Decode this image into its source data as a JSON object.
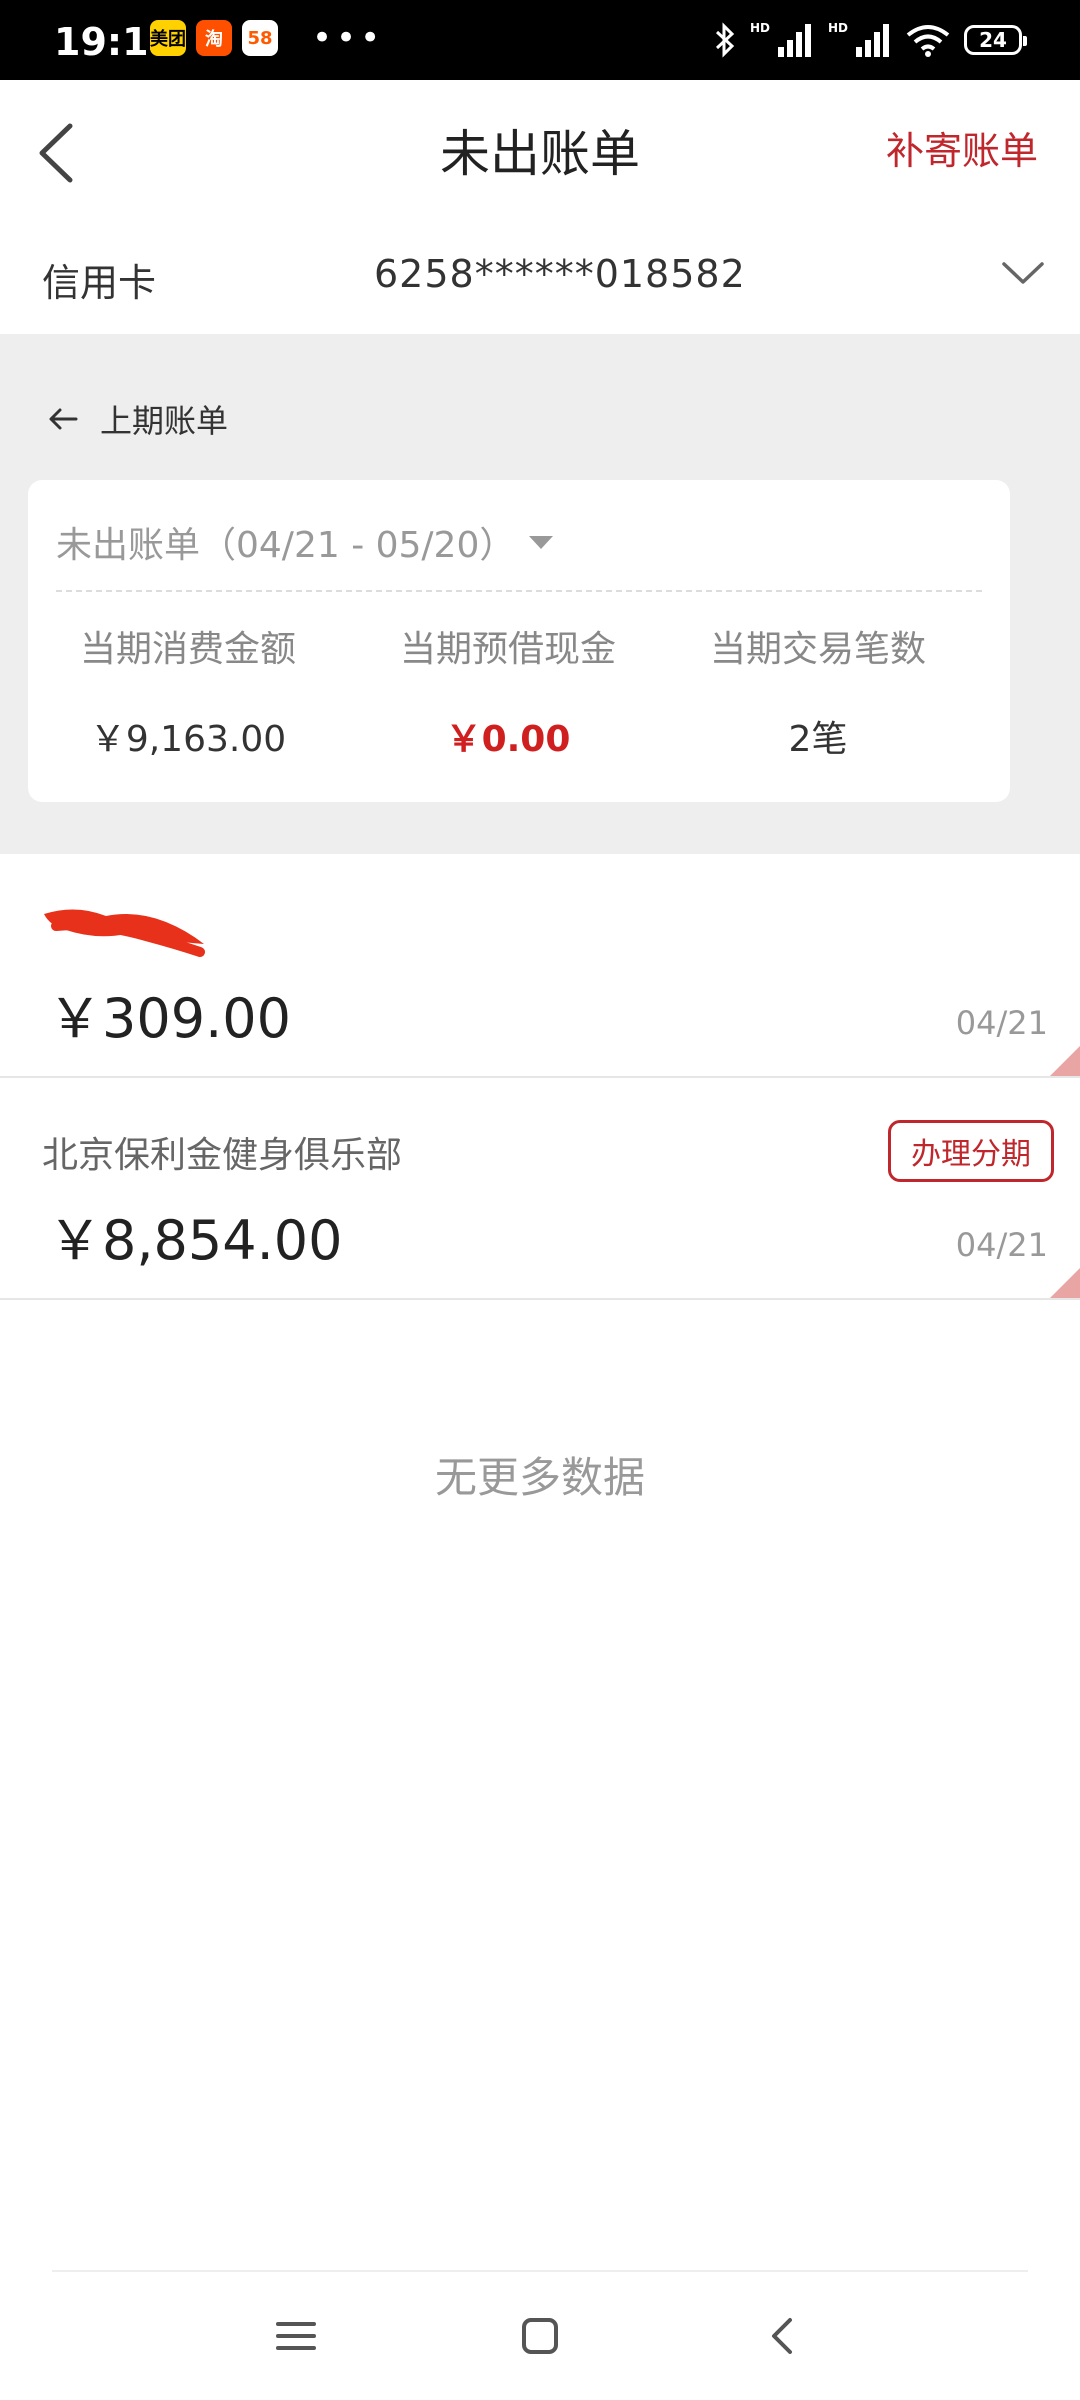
{
  "status_bar": {
    "time": "19:14",
    "app_icons": [
      {
        "name": "meituan-icon",
        "label": "美团"
      },
      {
        "name": "taobao-icon",
        "label": "淘"
      },
      {
        "name": "58-icon",
        "label": "58"
      }
    ],
    "more": "•••",
    "hd1": "HD",
    "hd2": "HD",
    "battery": "24"
  },
  "header": {
    "title": "未出账单",
    "right_action": "补寄账单"
  },
  "card": {
    "type": "信用卡",
    "number": "6258******018582"
  },
  "summary": {
    "prev_bill": "上期账单",
    "period": "未出账单（04/21 - 05/20）",
    "stats": [
      {
        "label": "当期消费金额",
        "value": "￥9,163.00"
      },
      {
        "label": "当期预借现金",
        "value": "￥0.00"
      },
      {
        "label": "当期交易笔数",
        "value": "2笔"
      }
    ]
  },
  "transactions": [
    {
      "merchant": "",
      "amount": "￥309.00",
      "date": "04/21"
    },
    {
      "merchant": "北京保利金健身俱乐部",
      "amount": "￥8,854.00",
      "date": "04/21",
      "action": "办理分期"
    }
  ],
  "footer": {
    "no_more": "无更多数据"
  },
  "colors": {
    "accent_red": "#c0272d",
    "value_red": "#d01f1f",
    "grey_bg": "#eeeeee"
  }
}
